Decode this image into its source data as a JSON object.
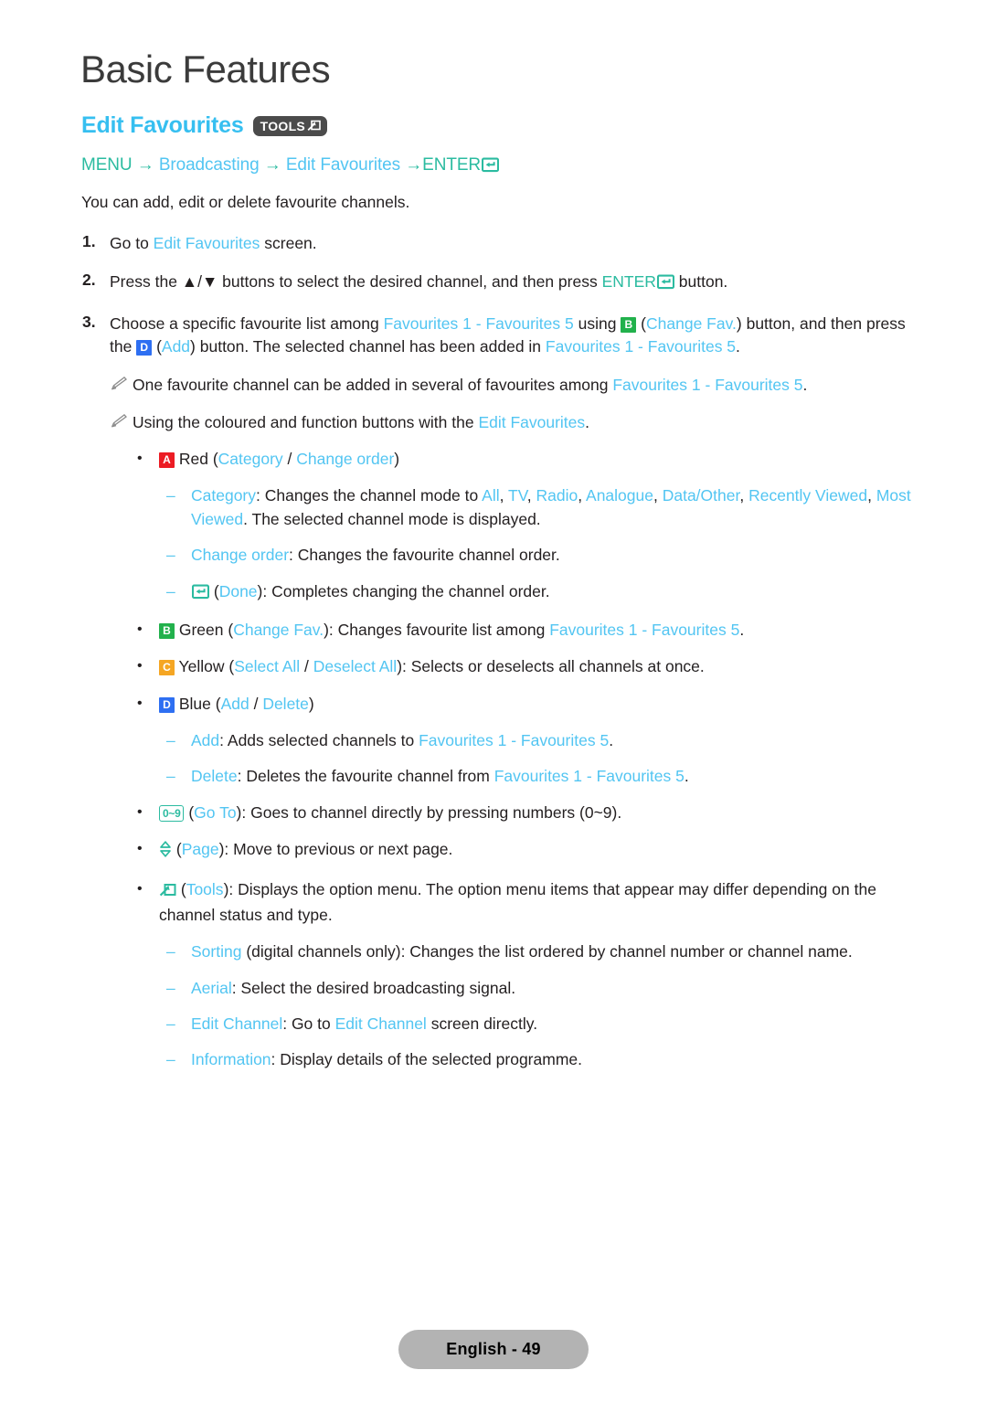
{
  "header": {
    "chapter_title": "Basic Features",
    "section_title": "Edit Favourites",
    "tools_badge_label": "TOOLS",
    "tools_badge_icon": "tools-arrow-icon"
  },
  "breadcrumb": {
    "menu": "MENU",
    "arrow": "→",
    "broadcasting": "Broadcasting",
    "edit_favourites": "Edit Favourites",
    "enter": "ENTER",
    "enter_icon": "enter-return-icon"
  },
  "intro": "You can add, edit or delete favourite channels.",
  "steps": [
    {
      "num": "1.",
      "parts": [
        {
          "t": "Go to ",
          "c": "black"
        },
        {
          "t": "Edit Favourites",
          "c": "blue"
        },
        {
          "t": " screen.",
          "c": "black"
        }
      ]
    },
    {
      "num": "2.",
      "parts": [
        {
          "t": "Press the ",
          "c": "black"
        },
        {
          "t": "▲/▼",
          "c": "black"
        },
        {
          "t": " buttons to select the desired channel, and then press ",
          "c": "black"
        },
        {
          "t": "ENTER",
          "c": "teal"
        },
        {
          "t": "[enter-icon]",
          "c": "icon-enter"
        },
        {
          "t": " button.",
          "c": "black"
        }
      ]
    },
    {
      "num": "3.",
      "parts": [
        {
          "t": "Choose a specific favourite list among ",
          "c": "black"
        },
        {
          "t": "Favourites 1 - Favourites 5",
          "c": "blue"
        },
        {
          "t": " using ",
          "c": "black"
        },
        {
          "t": "[key-b]",
          "c": "icon-key-b"
        },
        {
          "t": " (",
          "c": "black"
        },
        {
          "t": "Change Fav.",
          "c": "blue"
        },
        {
          "t": ") button, and then press the ",
          "c": "black"
        },
        {
          "t": "[key-d]",
          "c": "icon-key-d"
        },
        {
          "t": " (",
          "c": "black"
        },
        {
          "t": "Add",
          "c": "blue"
        },
        {
          "t": ") button. The selected channel has been added in ",
          "c": "black"
        },
        {
          "t": "Favourites 1 - Favourites 5",
          "c": "blue"
        },
        {
          "t": ".",
          "c": "black"
        }
      ]
    }
  ],
  "notes": [
    {
      "icon": "pencil-note-icon",
      "parts": [
        {
          "t": "One favourite channel can be added in several of favourites among ",
          "c": "black"
        },
        {
          "t": "Favourites 1 - Favourites 5",
          "c": "blue"
        },
        {
          "t": ".",
          "c": "black"
        }
      ]
    },
    {
      "icon": "pencil-note-icon",
      "parts": [
        {
          "t": "Using the coloured and function buttons with the ",
          "c": "black"
        },
        {
          "t": "Edit Favourites",
          "c": "blue"
        },
        {
          "t": ".",
          "c": "black"
        }
      ]
    }
  ],
  "bullets": {
    "red": {
      "dot": "•",
      "key": "A",
      "key_color": "#ec1c24",
      "parts": [
        {
          "t": "[key-a]",
          "c": "icon-key-a"
        },
        {
          "t": " Red (",
          "c": "black"
        },
        {
          "t": "Category",
          "c": "blue"
        },
        {
          "t": " / ",
          "c": "black"
        },
        {
          "t": "Change order",
          "c": "blue"
        },
        {
          "t": ")",
          "c": "black"
        }
      ]
    },
    "green": {
      "dot": "•",
      "key": "B",
      "key_color": "#22b14c",
      "parts": [
        {
          "t": "[key-b]",
          "c": "icon-key-b"
        },
        {
          "t": " Green (",
          "c": "black"
        },
        {
          "t": "Change Fav.",
          "c": "blue"
        },
        {
          "t": "): Changes favourite list among ",
          "c": "black"
        },
        {
          "t": "Favourites 1 - Favourites 5",
          "c": "blue"
        },
        {
          "t": ".",
          "c": "black"
        }
      ]
    },
    "yellow": {
      "dot": "•",
      "key": "C",
      "key_color": "#f5a623",
      "parts": [
        {
          "t": "[key-c]",
          "c": "icon-key-c"
        },
        {
          "t": " Yellow (",
          "c": "black"
        },
        {
          "t": "Select All",
          "c": "blue"
        },
        {
          "t": " / ",
          "c": "black"
        },
        {
          "t": "Deselect All",
          "c": "blue"
        },
        {
          "t": "): Selects or deselects all channels at once.",
          "c": "black"
        }
      ]
    },
    "blue": {
      "dot": "•",
      "key": "D",
      "key_color": "#2e6ff2",
      "parts": [
        {
          "t": "[key-d]",
          "c": "icon-key-d"
        },
        {
          "t": " Blue (",
          "c": "black"
        },
        {
          "t": "Add",
          "c": "blue"
        },
        {
          "t": " / ",
          "c": "black"
        },
        {
          "t": "Delete",
          "c": "blue"
        },
        {
          "t": ")",
          "c": "black"
        }
      ]
    },
    "goto": {
      "dot": "•",
      "key_label": "0~9",
      "parts": [
        {
          "t": "[key-09]",
          "c": "icon-key-09"
        },
        {
          "t": " (",
          "c": "black"
        },
        {
          "t": "Go To",
          "c": "blue"
        },
        {
          "t": "): Goes to channel directly by pressing numbers (0~9).",
          "c": "black"
        }
      ]
    },
    "page": {
      "dot": "•",
      "icon": "page-updown-icon",
      "parts": [
        {
          "t": "[icon-page]",
          "c": "icon-page"
        },
        {
          "t": " (",
          "c": "black"
        },
        {
          "t": "Page",
          "c": "blue"
        },
        {
          "t": "): Move to previous or next page.",
          "c": "black"
        }
      ]
    },
    "tools": {
      "dot": "•",
      "icon": "tools-arrow-icon",
      "parts": [
        {
          "t": "[icon-tools]",
          "c": "icon-tools"
        },
        {
          "t": " (",
          "c": "black"
        },
        {
          "t": "Tools",
          "c": "blue"
        },
        {
          "t": "): Displays the option menu. The option menu items that appear may differ depending on the channel status and type.",
          "c": "black"
        }
      ]
    }
  },
  "sub_items": {
    "category": {
      "dash": "–",
      "parts": [
        {
          "t": "Category",
          "c": "blue"
        },
        {
          "t": ": Changes the channel mode to ",
          "c": "black"
        },
        {
          "t": "All",
          "c": "blue"
        },
        {
          "t": ", ",
          "c": "black"
        },
        {
          "t": "TV",
          "c": "blue"
        },
        {
          "t": ", ",
          "c": "black"
        },
        {
          "t": "Radio",
          "c": "blue"
        },
        {
          "t": ", ",
          "c": "black"
        },
        {
          "t": "Analogue",
          "c": "blue"
        },
        {
          "t": ", ",
          "c": "black"
        },
        {
          "t": "Data/Other",
          "c": "blue"
        },
        {
          "t": ", ",
          "c": "black"
        },
        {
          "t": "Recently Viewed",
          "c": "blue"
        },
        {
          "t": ", ",
          "c": "black"
        },
        {
          "t": "Most Viewed",
          "c": "blue"
        },
        {
          "t": ". The selected channel mode is displayed.",
          "c": "black"
        }
      ]
    },
    "change_order": {
      "dash": "–",
      "parts": [
        {
          "t": "Change order",
          "c": "blue"
        },
        {
          "t": ": Changes the favourite channel order.",
          "c": "black"
        }
      ]
    },
    "done": {
      "dash": "–",
      "parts": [
        {
          "t": "[enter-icon]",
          "c": "icon-enter"
        },
        {
          "t": " (",
          "c": "black"
        },
        {
          "t": "Done",
          "c": "blue"
        },
        {
          "t": "): Completes changing the channel order.",
          "c": "black"
        }
      ]
    },
    "add": {
      "dash": "–",
      "parts": [
        {
          "t": "Add",
          "c": "blue"
        },
        {
          "t": ": Adds selected channels to ",
          "c": "black"
        },
        {
          "t": "Favourites 1 - Favourites 5",
          "c": "blue"
        },
        {
          "t": ".",
          "c": "black"
        }
      ]
    },
    "delete": {
      "dash": "–",
      "parts": [
        {
          "t": "Delete",
          "c": "blue"
        },
        {
          "t": ": Deletes the favourite channel from ",
          "c": "black"
        },
        {
          "t": "Favourites 1 - Favourites 5",
          "c": "blue"
        },
        {
          "t": ".",
          "c": "black"
        }
      ]
    },
    "sorting": {
      "dash": "–",
      "parts": [
        {
          "t": "Sorting",
          "c": "blue"
        },
        {
          "t": " (digital channels only): Changes the list ordered by channel number or channel name.",
          "c": "black"
        }
      ]
    },
    "aerial": {
      "dash": "–",
      "parts": [
        {
          "t": "Aerial",
          "c": "blue"
        },
        {
          "t": ": Select the desired broadcasting signal.",
          "c": "black"
        }
      ]
    },
    "edit_channel": {
      "dash": "–",
      "parts": [
        {
          "t": "Edit Channel",
          "c": "blue"
        },
        {
          "t": ": Go to ",
          "c": "black"
        },
        {
          "t": "Edit Channel",
          "c": "blue"
        },
        {
          "t": " screen directly.",
          "c": "black"
        }
      ]
    },
    "information": {
      "dash": "–",
      "parts": [
        {
          "t": "Information",
          "c": "blue"
        },
        {
          "t": ": Display details of the selected programme.",
          "c": "black"
        }
      ]
    }
  },
  "footer": {
    "page_label": "English - 49"
  },
  "colors": {
    "accent_blue": "#52c5f2",
    "accent_teal": "#2bbba0",
    "heading_blue": "#36bff0",
    "key_red": "#ec1c24",
    "key_green": "#22b14c",
    "key_yellow": "#f5a623",
    "key_blue": "#2e6ff2",
    "footer_pill": "#b3b3b3"
  }
}
